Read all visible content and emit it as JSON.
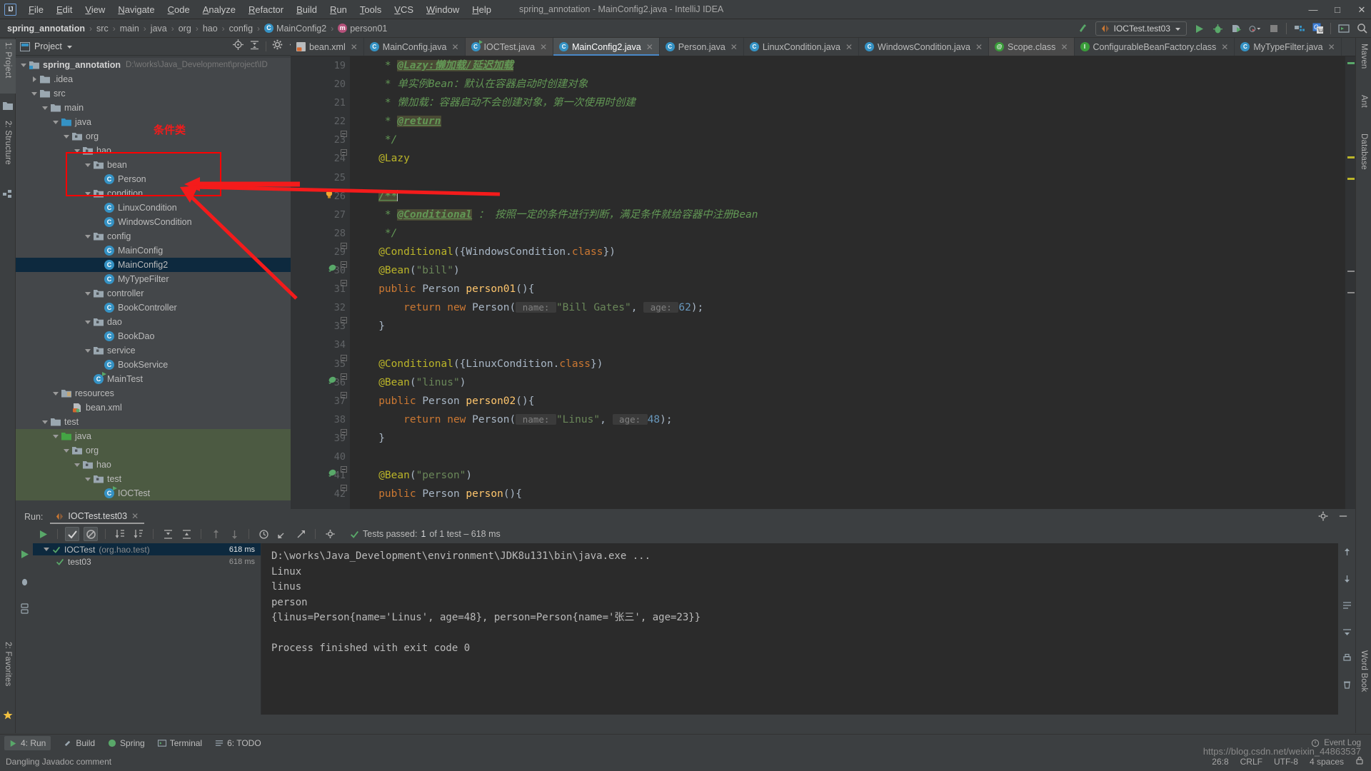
{
  "window": {
    "title": "spring_annotation - MainConfig2.java - IntelliJ IDEA",
    "logo": "IJ",
    "minimize": "—",
    "maximize": "□",
    "close": "✕"
  },
  "menu": [
    "File",
    "Edit",
    "View",
    "Navigate",
    "Code",
    "Analyze",
    "Refactor",
    "Build",
    "Run",
    "Tools",
    "VCS",
    "Window",
    "Help"
  ],
  "breadcrumb": [
    {
      "label": "spring_annotation",
      "icon": "none",
      "bold": true
    },
    {
      "label": "src",
      "icon": "none",
      "bold": false
    },
    {
      "label": "main",
      "icon": "none",
      "bold": false
    },
    {
      "label": "java",
      "icon": "none",
      "bold": false
    },
    {
      "label": "org",
      "icon": "none",
      "bold": false
    },
    {
      "label": "hao",
      "icon": "none",
      "bold": false
    },
    {
      "label": "config",
      "icon": "none",
      "bold": false
    },
    {
      "label": "MainConfig2",
      "icon": "class-icon",
      "bold": false
    },
    {
      "label": "person01",
      "icon": "method-icon",
      "bold": false
    }
  ],
  "toolbar": {
    "run_config": "IOCTest.test03",
    "icons": [
      "back-arrow-icon",
      "run-icon",
      "debug-icon",
      "run-with-coverage-icon",
      "profile-icon",
      "stop-icon",
      "build-project-icon",
      "translate-icon",
      "terminal-icon",
      "search-everywhere-icon"
    ]
  },
  "left_strip": {
    "tabs": [
      "1: Project",
      "2: Structure"
    ],
    "bottom": [
      "2: Favorites"
    ]
  },
  "right_strip": {
    "tabs": [
      "Maven",
      "Ant",
      "Database",
      "Word Book"
    ]
  },
  "project_panel": {
    "title": "Project",
    "actions": [
      "locate-icon",
      "collapse-all-icon",
      "settings-icon",
      "hide-icon"
    ],
    "tree": [
      {
        "indent": 0,
        "arrow": "down",
        "icon": "project-folder",
        "label": "spring_annotation",
        "bold": true,
        "path": "D:\\works\\Java_Development\\project\\ID",
        "state": "mod"
      },
      {
        "indent": 1,
        "arrow": "right",
        "icon": "folder",
        "label": ".idea",
        "bold": false,
        "path": "",
        "state": "mod"
      },
      {
        "indent": 1,
        "arrow": "down",
        "icon": "folder",
        "label": "src",
        "bold": false,
        "path": "",
        "state": "mod"
      },
      {
        "indent": 2,
        "arrow": "down",
        "icon": "folder",
        "label": "main",
        "bold": false,
        "path": "",
        "state": "mod"
      },
      {
        "indent": 3,
        "arrow": "down",
        "icon": "folder-blue",
        "label": "java",
        "bold": false,
        "path": "",
        "state": "mod"
      },
      {
        "indent": 4,
        "arrow": "down",
        "icon": "package",
        "label": "org",
        "bold": false,
        "path": "",
        "state": "mod"
      },
      {
        "indent": 5,
        "arrow": "down",
        "icon": "package",
        "label": "hao",
        "bold": false,
        "path": "",
        "state": "mod"
      },
      {
        "indent": 6,
        "arrow": "down",
        "icon": "package",
        "label": "bean",
        "bold": false,
        "path": "",
        "state": "mod"
      },
      {
        "indent": 7,
        "arrow": "none",
        "icon": "class",
        "label": "Person",
        "bold": false,
        "path": "",
        "state": "mod"
      },
      {
        "indent": 6,
        "arrow": "down",
        "icon": "package",
        "label": "condition",
        "bold": false,
        "path": "",
        "state": "mod"
      },
      {
        "indent": 7,
        "arrow": "none",
        "icon": "class",
        "label": "LinuxCondition",
        "bold": false,
        "path": "",
        "state": "mod"
      },
      {
        "indent": 7,
        "arrow": "none",
        "icon": "class",
        "label": "WindowsCondition",
        "bold": false,
        "path": "",
        "state": "mod"
      },
      {
        "indent": 6,
        "arrow": "down",
        "icon": "package",
        "label": "config",
        "bold": false,
        "path": "",
        "state": "mod"
      },
      {
        "indent": 7,
        "arrow": "none",
        "icon": "class",
        "label": "MainConfig",
        "bold": false,
        "path": "",
        "state": "mod"
      },
      {
        "indent": 7,
        "arrow": "none",
        "icon": "class",
        "label": "MainConfig2",
        "bold": false,
        "path": "",
        "state": "sel"
      },
      {
        "indent": 7,
        "arrow": "none",
        "icon": "class",
        "label": "MyTypeFilter",
        "bold": false,
        "path": "",
        "state": "mod"
      },
      {
        "indent": 6,
        "arrow": "down",
        "icon": "package",
        "label": "controller",
        "bold": false,
        "path": "",
        "state": "mod"
      },
      {
        "indent": 7,
        "arrow": "none",
        "icon": "class",
        "label": "BookController",
        "bold": false,
        "path": "",
        "state": "mod"
      },
      {
        "indent": 6,
        "arrow": "down",
        "icon": "package",
        "label": "dao",
        "bold": false,
        "path": "",
        "state": "mod"
      },
      {
        "indent": 7,
        "arrow": "none",
        "icon": "class",
        "label": "BookDao",
        "bold": false,
        "path": "",
        "state": "mod"
      },
      {
        "indent": 6,
        "arrow": "down",
        "icon": "package",
        "label": "service",
        "bold": false,
        "path": "",
        "state": "mod"
      },
      {
        "indent": 7,
        "arrow": "none",
        "icon": "class",
        "label": "BookService",
        "bold": false,
        "path": "",
        "state": "mod"
      },
      {
        "indent": 6,
        "arrow": "none",
        "icon": "class-runnable",
        "label": "MainTest",
        "bold": false,
        "path": "",
        "state": "mod"
      },
      {
        "indent": 3,
        "arrow": "down",
        "icon": "resources",
        "label": "resources",
        "bold": false,
        "path": "",
        "state": "mod"
      },
      {
        "indent": 4,
        "arrow": "none",
        "icon": "xml",
        "label": "bean.xml",
        "bold": false,
        "path": "",
        "state": "mod"
      },
      {
        "indent": 2,
        "arrow": "down",
        "icon": "folder",
        "label": "test",
        "bold": false,
        "path": "",
        "state": "mod"
      },
      {
        "indent": 3,
        "arrow": "down",
        "icon": "folder-green",
        "label": "java",
        "bold": false,
        "path": "",
        "state": "green"
      },
      {
        "indent": 4,
        "arrow": "down",
        "icon": "package",
        "label": "org",
        "bold": false,
        "path": "",
        "state": "green"
      },
      {
        "indent": 5,
        "arrow": "down",
        "icon": "package",
        "label": "hao",
        "bold": false,
        "path": "",
        "state": "green"
      },
      {
        "indent": 6,
        "arrow": "down",
        "icon": "package",
        "label": "test",
        "bold": false,
        "path": "",
        "state": "green"
      },
      {
        "indent": 7,
        "arrow": "none",
        "icon": "class-runnable",
        "label": "IOCTest",
        "bold": false,
        "path": "",
        "state": "green"
      }
    ]
  },
  "annotation": {
    "label": "条件类",
    "color": "#f41b1b"
  },
  "editor": {
    "tabs": [
      {
        "label": "bean.xml",
        "icon": "xml-icon",
        "active": false,
        "alt": false
      },
      {
        "label": "MainConfig.java",
        "icon": "class-icon",
        "active": false,
        "alt": false
      },
      {
        "label": "IOCTest.java",
        "icon": "test-class-icon",
        "active": false,
        "alt": true
      },
      {
        "label": "MainConfig2.java",
        "icon": "class-icon",
        "active": true,
        "alt": false
      },
      {
        "label": "Person.java",
        "icon": "class-icon",
        "active": false,
        "alt": false
      },
      {
        "label": "LinuxCondition.java",
        "icon": "class-icon",
        "active": false,
        "alt": false
      },
      {
        "label": "WindowsCondition.java",
        "icon": "class-icon",
        "active": false,
        "alt": false
      },
      {
        "label": "Scope.class",
        "icon": "annotation-icon",
        "active": false,
        "alt": true
      },
      {
        "label": "ConfigurableBeanFactory.class",
        "icon": "interface-icon",
        "active": false,
        "alt": false
      },
      {
        "label": "MyTypeFilter.java",
        "icon": "class-icon",
        "active": false,
        "alt": false
      }
    ],
    "first_line_number": 19,
    "lines": [
      {
        "n": 19,
        "fold": false,
        "run": false,
        "bulb": false,
        "tokens": [
          {
            "t": "    * ",
            "c": "c-cmt"
          },
          {
            "t": "@Lazy:懒加载/延迟加载",
            "c": "c-tag"
          }
        ]
      },
      {
        "n": 20,
        "fold": false,
        "run": false,
        "bulb": false,
        "tokens": [
          {
            "t": "    * 单实例Bean：默认在容器启动时创建对象",
            "c": "c-cmt"
          }
        ]
      },
      {
        "n": 21,
        "fold": false,
        "run": false,
        "bulb": false,
        "tokens": [
          {
            "t": "    * 懒加载：容器启动不会创建对象，第一次使用时创建",
            "c": "c-cmt"
          }
        ]
      },
      {
        "n": 22,
        "fold": false,
        "run": false,
        "bulb": false,
        "tokens": [
          {
            "t": "    * ",
            "c": "c-cmt"
          },
          {
            "t": "@return",
            "c": "c-tag"
          }
        ]
      },
      {
        "n": 23,
        "fold": true,
        "run": false,
        "bulb": false,
        "tokens": [
          {
            "t": "    */",
            "c": "c-cmt"
          }
        ]
      },
      {
        "n": 24,
        "fold": true,
        "run": false,
        "bulb": false,
        "tokens": [
          {
            "t": "   @Lazy",
            "c": "c-ann"
          }
        ]
      },
      {
        "n": 25,
        "fold": false,
        "run": false,
        "bulb": false,
        "tokens": []
      },
      {
        "n": 26,
        "fold": false,
        "run": false,
        "bulb": true,
        "tokens": [
          {
            "t": "   ",
            "c": "c-def"
          },
          {
            "t": "/**",
            "c": "c-tag"
          },
          {
            "t": "│",
            "c": "caret"
          }
        ]
      },
      {
        "n": 27,
        "fold": false,
        "run": false,
        "bulb": false,
        "tokens": [
          {
            "t": "    * ",
            "c": "c-cmt"
          },
          {
            "t": "@Conditional",
            "c": "c-tag"
          },
          {
            "t": " ： 按照一定的条件进行判断，满足条件就给容器中注册Bean",
            "c": "c-cmt"
          }
        ]
      },
      {
        "n": 28,
        "fold": false,
        "run": false,
        "bulb": false,
        "tokens": [
          {
            "t": "    */",
            "c": "c-cmt"
          }
        ]
      },
      {
        "n": 29,
        "fold": true,
        "run": false,
        "bulb": false,
        "tokens": [
          {
            "t": "   @Conditional",
            "c": "c-ann"
          },
          {
            "t": "({",
            "c": "c-def"
          },
          {
            "t": "WindowsCondition",
            "c": "c-cls"
          },
          {
            "t": ".",
            "c": "c-def"
          },
          {
            "t": "class",
            "c": "c-kw"
          },
          {
            "t": "})",
            "c": "c-def"
          }
        ]
      },
      {
        "n": 30,
        "fold": true,
        "run": true,
        "bulb": false,
        "tokens": [
          {
            "t": "   @Bean",
            "c": "c-ann"
          },
          {
            "t": "(",
            "c": "c-def"
          },
          {
            "t": "\"bill\"",
            "c": "c-str"
          },
          {
            "t": ")",
            "c": "c-def"
          }
        ]
      },
      {
        "n": 31,
        "fold": true,
        "run": false,
        "bulb": false,
        "tokens": [
          {
            "t": "   public ",
            "c": "c-kw"
          },
          {
            "t": "Person ",
            "c": "c-cls"
          },
          {
            "t": "person01",
            "c": "c-mth"
          },
          {
            "t": "(){",
            "c": "c-def"
          }
        ]
      },
      {
        "n": 32,
        "fold": false,
        "run": false,
        "bulb": false,
        "tokens": [
          {
            "t": "       return new ",
            "c": "c-kw"
          },
          {
            "t": "Person",
            "c": "c-cls"
          },
          {
            "t": "(",
            "c": "c-def"
          },
          {
            "t": " name: ",
            "c": "hint"
          },
          {
            "t": "\"Bill Gates\"",
            "c": "c-str"
          },
          {
            "t": ", ",
            "c": "c-def"
          },
          {
            "t": " age: ",
            "c": "hint"
          },
          {
            "t": "62",
            "c": "c-num"
          },
          {
            "t": ");",
            "c": "c-def"
          }
        ]
      },
      {
        "n": 33,
        "fold": true,
        "run": false,
        "bulb": false,
        "tokens": [
          {
            "t": "   }",
            "c": "c-def"
          }
        ]
      },
      {
        "n": 34,
        "fold": false,
        "run": false,
        "bulb": false,
        "tokens": []
      },
      {
        "n": 35,
        "fold": true,
        "run": false,
        "bulb": false,
        "tokens": [
          {
            "t": "   @Conditional",
            "c": "c-ann"
          },
          {
            "t": "({",
            "c": "c-def"
          },
          {
            "t": "LinuxCondition",
            "c": "c-cls"
          },
          {
            "t": ".",
            "c": "c-def"
          },
          {
            "t": "class",
            "c": "c-kw"
          },
          {
            "t": "})",
            "c": "c-def"
          }
        ]
      },
      {
        "n": 36,
        "fold": true,
        "run": true,
        "bulb": false,
        "tokens": [
          {
            "t": "   @Bean",
            "c": "c-ann"
          },
          {
            "t": "(",
            "c": "c-def"
          },
          {
            "t": "\"linus\"",
            "c": "c-str"
          },
          {
            "t": ")",
            "c": "c-def"
          }
        ]
      },
      {
        "n": 37,
        "fold": true,
        "run": false,
        "bulb": false,
        "tokens": [
          {
            "t": "   public ",
            "c": "c-kw"
          },
          {
            "t": "Person ",
            "c": "c-cls"
          },
          {
            "t": "person02",
            "c": "c-mth"
          },
          {
            "t": "(){",
            "c": "c-def"
          }
        ]
      },
      {
        "n": 38,
        "fold": false,
        "run": false,
        "bulb": false,
        "tokens": [
          {
            "t": "       return new ",
            "c": "c-kw"
          },
          {
            "t": "Person",
            "c": "c-cls"
          },
          {
            "t": "(",
            "c": "c-def"
          },
          {
            "t": " name: ",
            "c": "hint"
          },
          {
            "t": "\"Linus\"",
            "c": "c-str"
          },
          {
            "t": ", ",
            "c": "c-def"
          },
          {
            "t": " age: ",
            "c": "hint"
          },
          {
            "t": "48",
            "c": "c-num"
          },
          {
            "t": ");",
            "c": "c-def"
          }
        ]
      },
      {
        "n": 39,
        "fold": true,
        "run": false,
        "bulb": false,
        "tokens": [
          {
            "t": "   }",
            "c": "c-def"
          }
        ]
      },
      {
        "n": 40,
        "fold": false,
        "run": false,
        "bulb": false,
        "tokens": []
      },
      {
        "n": 41,
        "fold": true,
        "run": true,
        "bulb": false,
        "tokens": [
          {
            "t": "   @Bean",
            "c": "c-ann"
          },
          {
            "t": "(",
            "c": "c-def"
          },
          {
            "t": "\"person\"",
            "c": "c-str"
          },
          {
            "t": ")",
            "c": "c-def"
          }
        ]
      },
      {
        "n": 42,
        "fold": true,
        "run": false,
        "bulb": false,
        "tokens": [
          {
            "t": "   public ",
            "c": "c-kw"
          },
          {
            "t": "Person ",
            "c": "c-cls"
          },
          {
            "t": "person",
            "c": "c-mth"
          },
          {
            "t": "(){",
            "c": "c-def"
          }
        ]
      }
    ]
  },
  "run_panel": {
    "label": "Run:",
    "tab": "IOCTest.test03",
    "toolbar_icons": [
      "rerun-icon",
      "toggle-passed-icon",
      "toggle-ignored-icon",
      "sort-alpha-icon",
      "sort-duration-icon",
      "expand-all-icon",
      "collapse-all-icon",
      "prev-icon",
      "next-icon",
      "history-icon",
      "import-icon",
      "export-icon",
      "settings-icon"
    ],
    "status_prefix": "Tests passed:",
    "status_count": "1",
    "status_suffix": "of 1 test – 618 ms",
    "tree": [
      {
        "label": "IOCTest",
        "sub": "(org.hao.test)",
        "time": "618 ms",
        "selected": true,
        "indent": 0
      },
      {
        "label": "test03",
        "sub": "",
        "time": "618 ms",
        "selected": false,
        "indent": 1
      }
    ],
    "console": [
      {
        "text": "D:\\works\\Java_Development\\environment\\JDK8u131\\bin\\java.exe ...",
        "cmd": true
      },
      {
        "text": "Linux",
        "cmd": false
      },
      {
        "text": "linus",
        "cmd": false
      },
      {
        "text": "person",
        "cmd": false
      },
      {
        "text": "{linus=Person{name='Linus', age=48}, person=Person{name='张三', age=23}}",
        "cmd": false
      },
      {
        "text": "",
        "cmd": false
      },
      {
        "text": "Process finished with exit code 0",
        "cmd": false
      }
    ]
  },
  "bottom_bar": {
    "items": [
      {
        "label": "4: Run",
        "icon": "run-icon",
        "active": true
      },
      {
        "label": "Build",
        "icon": "build-icon",
        "active": false
      },
      {
        "label": "Spring",
        "icon": "spring-icon",
        "active": false
      },
      {
        "label": "Terminal",
        "icon": "terminal-icon",
        "active": false
      },
      {
        "label": "6: TODO",
        "icon": "todo-icon",
        "active": false
      }
    ],
    "event_log": "Event Log"
  },
  "status_bar": {
    "message": "Dangling Javadoc comment",
    "position": "26:8",
    "line_sep": "CRLF",
    "encoding": "UTF-8",
    "indent": "4 spaces",
    "lock_icon": "lock-icon"
  },
  "watermark": {
    "url": "https://blog.csdn.net/weixin_44863537"
  }
}
